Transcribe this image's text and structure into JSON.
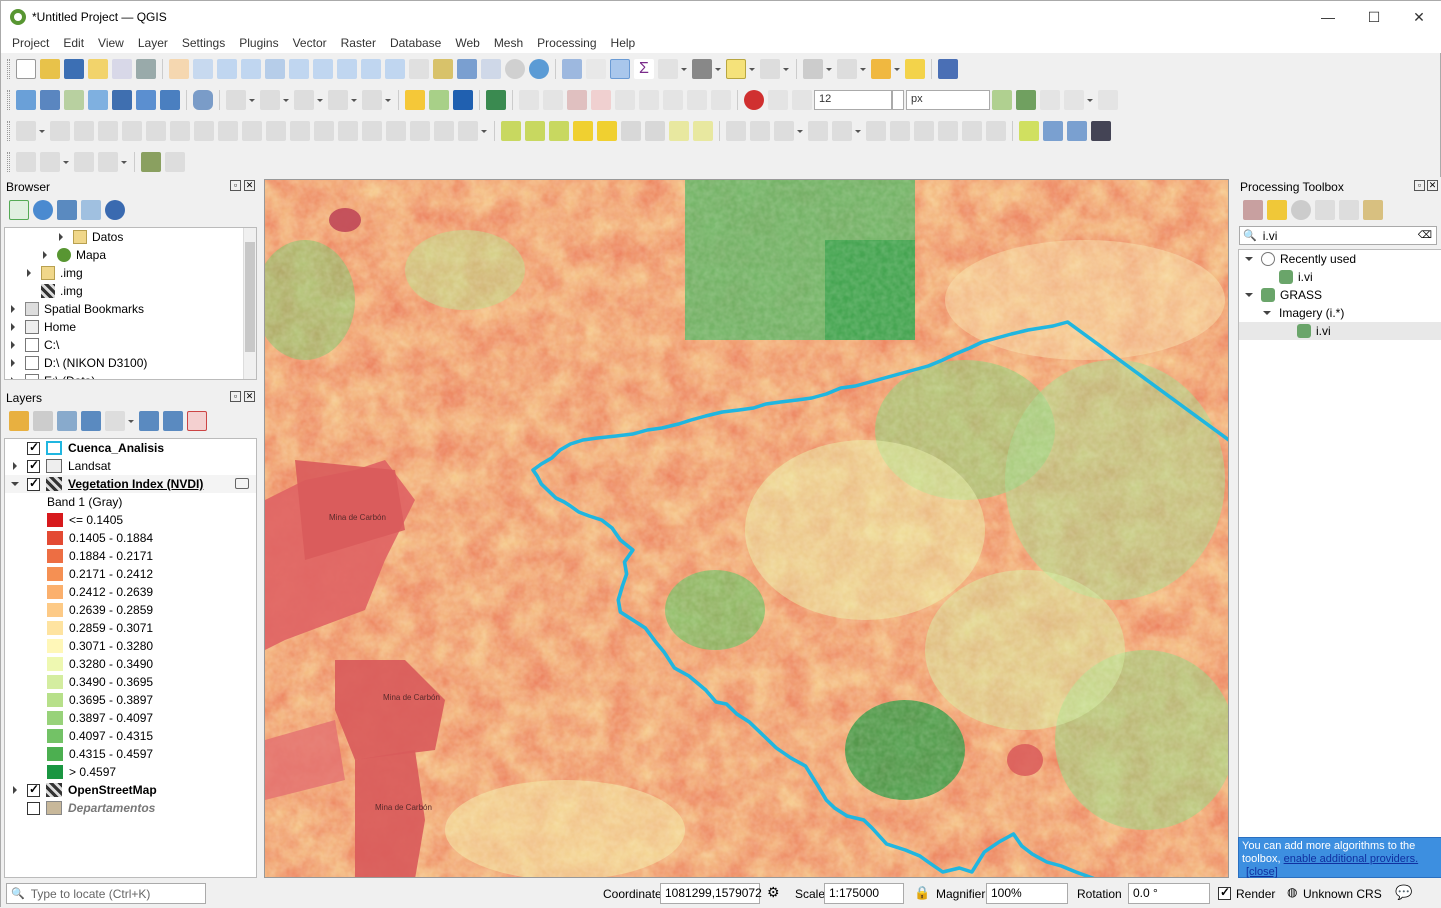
{
  "window": {
    "title": "*Untitled Project — QGIS"
  },
  "menu": [
    "Project",
    "Edit",
    "View",
    "Layer",
    "Settings",
    "Plugins",
    "Vector",
    "Raster",
    "Database",
    "Web",
    "Mesh",
    "Processing",
    "Help"
  ],
  "toolbar": {
    "font_size_value": "12",
    "unit_value": "px"
  },
  "browser": {
    "title": "Browser",
    "items": [
      {
        "label": "Datos",
        "indent": 3,
        "expander": "right",
        "icon": "folder-icon"
      },
      {
        "label": "Mapa",
        "indent": 2,
        "expander": "right",
        "icon": "qgis-project-icon"
      },
      {
        "label": ".img",
        "indent": 1,
        "expander": "right",
        "icon": "folder-icon"
      },
      {
        "label": ".img",
        "indent": 1,
        "expander": "none",
        "icon": "raster-icon"
      },
      {
        "label": "Spatial Bookmarks",
        "indent": 0,
        "expander": "right",
        "icon": "bookmark-icon"
      },
      {
        "label": "Home",
        "indent": 0,
        "expander": "right",
        "icon": "home-icon"
      },
      {
        "label": "C:\\",
        "indent": 0,
        "expander": "right",
        "icon": "drive-icon"
      },
      {
        "label": "D:\\ (NIKON D3100)",
        "indent": 0,
        "expander": "right",
        "icon": "drive-icon"
      },
      {
        "label": "E:\\ (Data)",
        "indent": 0,
        "expander": "right",
        "icon": "drive-icon"
      }
    ]
  },
  "layers": {
    "title": "Layers",
    "cuenca": "Cuenca_Analisis",
    "landsat": "Landsat",
    "ndvi": "Vegetation Index (NVDI)",
    "band": "Band 1 (Gray)",
    "legend": [
      {
        "label": "<= 0.1405",
        "color": "#d7191c"
      },
      {
        "label": "0.1405 - 0.1884",
        "color": "#e34a33"
      },
      {
        "label": "0.1884 - 0.2171",
        "color": "#ed6e43"
      },
      {
        "label": "0.2171 - 0.2412",
        "color": "#f59053"
      },
      {
        "label": "0.2412 - 0.2639",
        "color": "#fbb06d"
      },
      {
        "label": "0.2639 - 0.2859",
        "color": "#fdca86"
      },
      {
        "label": "0.2859 - 0.3071",
        "color": "#fee3a0"
      },
      {
        "label": "0.3071 - 0.3280",
        "color": "#fff7b8"
      },
      {
        "label": "0.3280 - 0.3490",
        "color": "#eef8b1"
      },
      {
        "label": "0.3490 - 0.3695",
        "color": "#d4eda0"
      },
      {
        "label": "0.3695 - 0.3897",
        "color": "#b7e08a"
      },
      {
        "label": "0.3897 - 0.4097",
        "color": "#98d27a"
      },
      {
        "label": "0.4097 - 0.4315",
        "color": "#73c266"
      },
      {
        "label": "0.4315 - 0.4597",
        "color": "#4caf50"
      },
      {
        "label": "> 0.4597",
        "color": "#1a9641"
      }
    ],
    "osm": "OpenStreetMap",
    "departamentos": "Departamentos"
  },
  "map_labels": [
    "Mina de Carbón",
    "Mina de Carbón",
    "Mina de Carbón"
  ],
  "processing": {
    "title": "Processing Toolbox",
    "search_value": "i.vi",
    "tree": [
      {
        "label": "Recently used",
        "indent": 0,
        "expander": "down",
        "icon": "clock-icon"
      },
      {
        "label": "i.vi",
        "indent": 1,
        "expander": "none",
        "icon": "grass-icon"
      },
      {
        "label": "GRASS",
        "indent": 0,
        "expander": "down",
        "icon": "grass-icon"
      },
      {
        "label": "Imagery (i.*)",
        "indent": 1,
        "expander": "down",
        "icon": "none"
      },
      {
        "label": "i.vi",
        "indent": 2,
        "expander": "none",
        "icon": "grass-icon"
      }
    ],
    "notice_text": "You can add more algorithms to the toolbox,",
    "notice_link": "enable additional providers.",
    "notice_close": "[close]"
  },
  "status": {
    "locate_placeholder": "Type to locate (Ctrl+K)",
    "coordinate_label": "Coordinate",
    "coordinate_value": "1081299,1579072",
    "scale_label": "Scale",
    "scale_value": "1:175000",
    "magnifier_label": "Magnifier",
    "magnifier_value": "100%",
    "rotation_label": "Rotation",
    "rotation_value": "0.0 °",
    "render_label": "Render",
    "crs_label": "Unknown CRS"
  },
  "colors": {
    "accent": "#1a7ad7",
    "boundary": "#20b6e0",
    "notice_bg": "#3d8fe0"
  }
}
